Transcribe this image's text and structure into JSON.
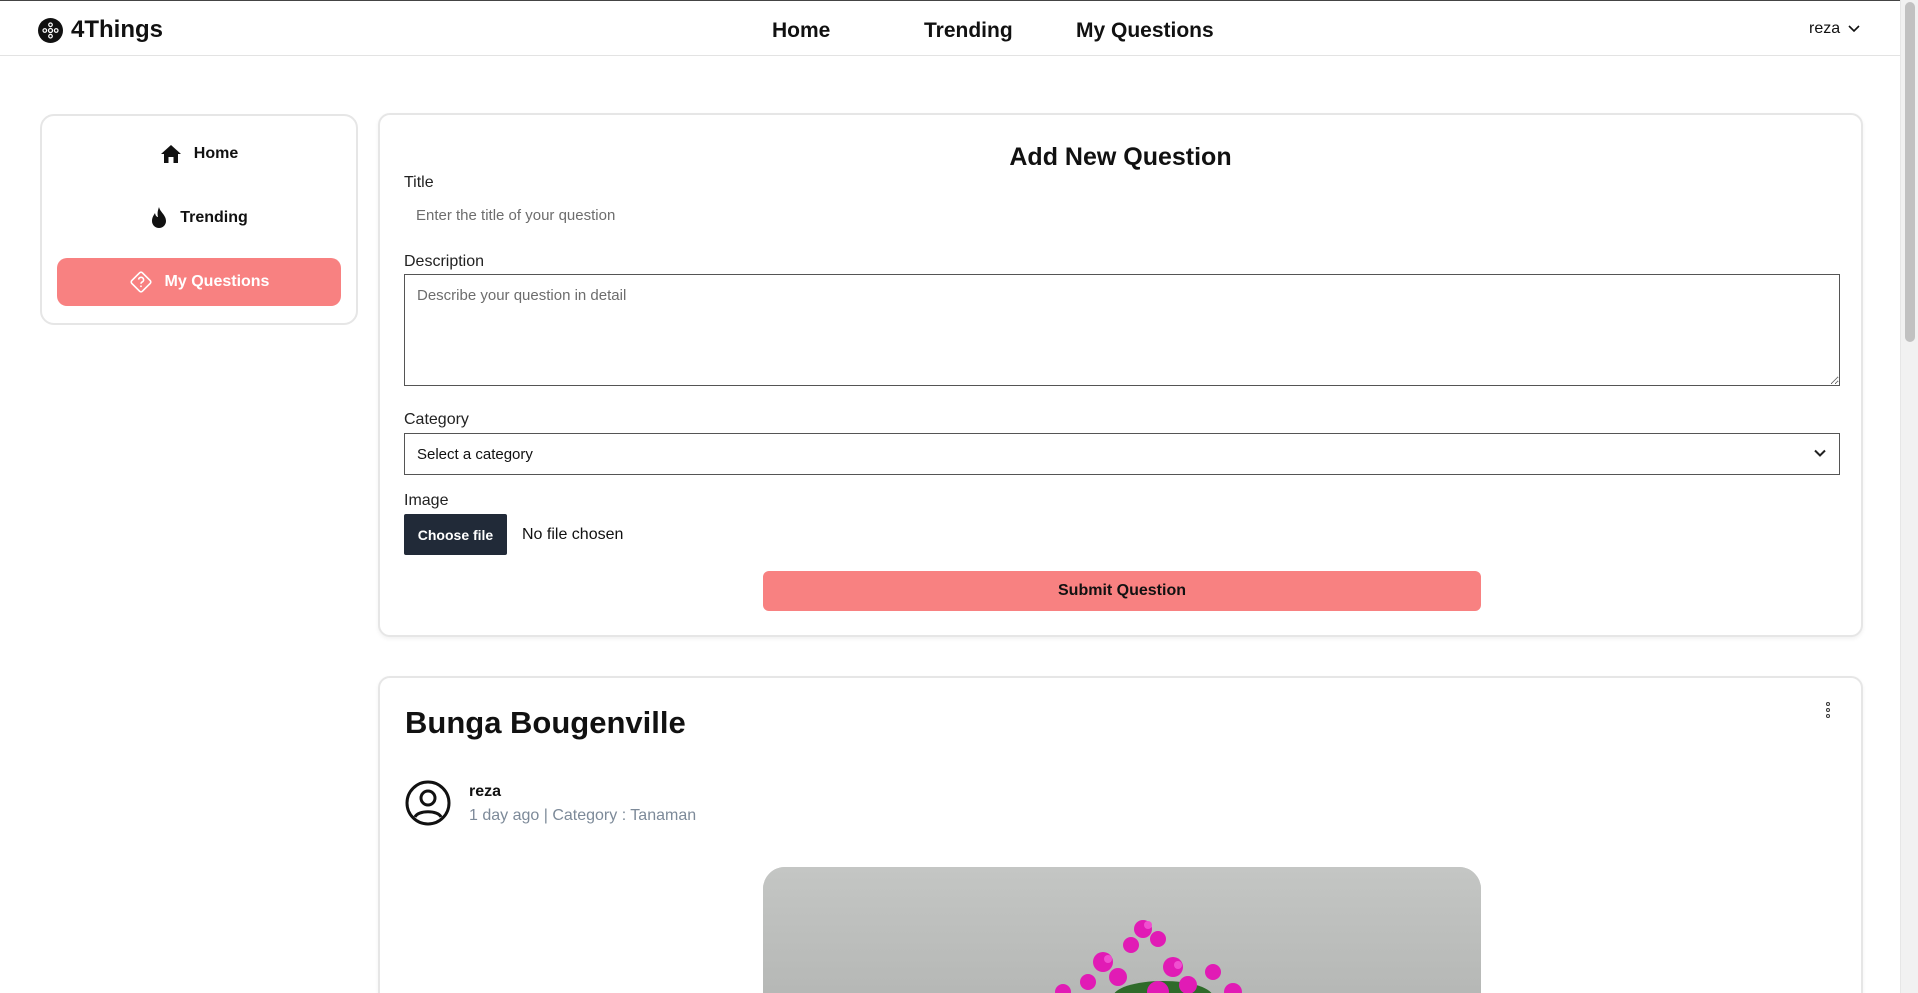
{
  "app": {
    "brand": "4Things"
  },
  "topnav": {
    "items": [
      {
        "label": "Home"
      },
      {
        "label": "Trending"
      },
      {
        "label": "My Questions"
      }
    ],
    "user": "reza"
  },
  "sidebar": {
    "items": [
      {
        "label": "Home",
        "icon": "home-icon"
      },
      {
        "label": "Trending",
        "icon": "fire-icon"
      },
      {
        "label": "My Questions",
        "icon": "question-diamond-icon",
        "active": true
      }
    ]
  },
  "form": {
    "title": "Add New Question",
    "title_label": "Title",
    "title_placeholder": "Enter the title of your question",
    "description_label": "Description",
    "description_placeholder": "Describe your question in detail",
    "category_label": "Category",
    "category_selected": "Select a category",
    "image_label": "Image",
    "file_button": "Choose file",
    "file_status": "No file chosen",
    "submit_label": "Submit Question"
  },
  "question": {
    "title": "Bunga Bougenville",
    "author": "reza",
    "meta": "1 day ago | Category : Tanaman"
  },
  "colors": {
    "accent": "#f88181",
    "dark_button": "#212a38",
    "meta_text": "#7d8a99"
  }
}
